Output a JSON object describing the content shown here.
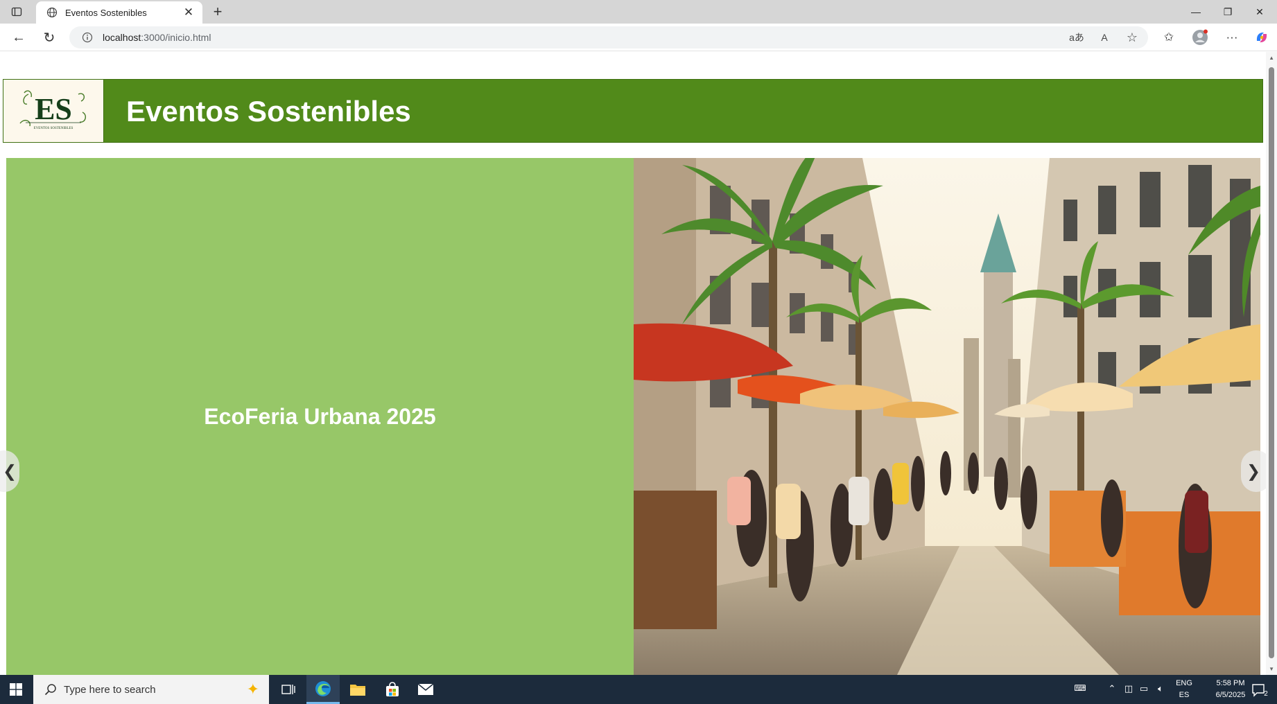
{
  "browser": {
    "tab": {
      "title": "Eventos Sostenibles",
      "close_glyph": "✕"
    },
    "new_tab_glyph": "+",
    "window_controls": {
      "minimize": "—",
      "restore": "❐",
      "close": "✕"
    },
    "nav": {
      "back_glyph": "←",
      "reload_glyph": "↻"
    },
    "url": {
      "host": "localhost",
      "path": ":3000/inicio.html"
    },
    "url_actions": {
      "translate": "aあ",
      "read_aloud": "A",
      "favorite": "☆"
    },
    "toolbar": {
      "favorites": "✩",
      "more": "···"
    }
  },
  "page": {
    "header": {
      "logo_text": "ES",
      "logo_subtext": "EVENTOS SOSTENIBLES",
      "title": "Eventos Sostenibles"
    },
    "carousel": {
      "slide_caption": "EcoFeria Urbana 2025",
      "prev_glyph": "❮",
      "next_glyph": "❯"
    }
  },
  "taskbar": {
    "search_placeholder": "Type here to search",
    "language": {
      "line1": "ENG",
      "line2": "ES"
    },
    "clock": {
      "time": "5:58 PM",
      "date": "6/5/2025"
    },
    "notification_count": "2"
  },
  "colors": {
    "header_green": "#518a1a",
    "slide_green": "#97c768",
    "taskbar": "#1c2b3c"
  },
  "icons": [
    "tab-actions-icon",
    "globe-icon",
    "info-icon",
    "profile-icon",
    "copilot-icon",
    "windows-icon",
    "search-icon",
    "task-view-icon",
    "edge-icon",
    "file-explorer-icon",
    "store-icon",
    "mail-icon",
    "network-icon",
    "volume-icon",
    "notification-icon"
  ]
}
